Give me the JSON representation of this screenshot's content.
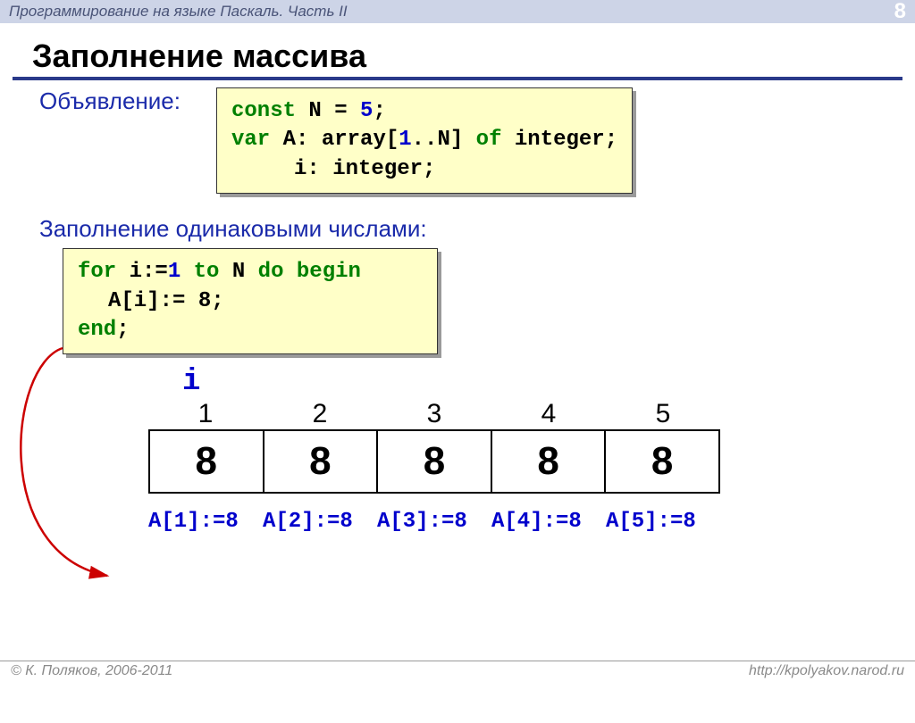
{
  "header": {
    "subject": "Программирование на языке Паскаль. Часть II",
    "page": "8"
  },
  "title": "Заполнение массива",
  "labels": {
    "declaration": "Объявление:",
    "fill_same": "Заполнение одинаковыми числами:"
  },
  "code1": {
    "l1_kw": "const",
    "l1_rest": " N = ",
    "l1_num": "5",
    "l1_tail": ";",
    "l2_kw": "var",
    "l2_rest": " A: array[",
    "l2_num1": "1",
    "l2_mid": "..N] ",
    "l2_kw2": "of",
    "l2_tail": " integer;",
    "l3": "i: integer;"
  },
  "code2": {
    "l1a": "for",
    "l1b": " i:=",
    "l1n": "1",
    "l1c": " ",
    "l1d": "to",
    "l1e": " N ",
    "l1f": "do",
    "l1g": " ",
    "l1h": "begin",
    "l2": "A[i]:= 8;",
    "l3": "end",
    "l3b": ";"
  },
  "i_label": "i",
  "array": {
    "indices": [
      "1",
      "2",
      "3",
      "4",
      "5"
    ],
    "values": [
      "8",
      "8",
      "8",
      "8",
      "8"
    ]
  },
  "assignments": [
    "A[1]:=8",
    "A[2]:=8",
    "A[3]:=8",
    "A[4]:=8",
    "A[5]:=8"
  ],
  "footer": {
    "copyright": "© К. Поляков, 2006-2011",
    "url": "http://kpolyakov.narod.ru"
  }
}
